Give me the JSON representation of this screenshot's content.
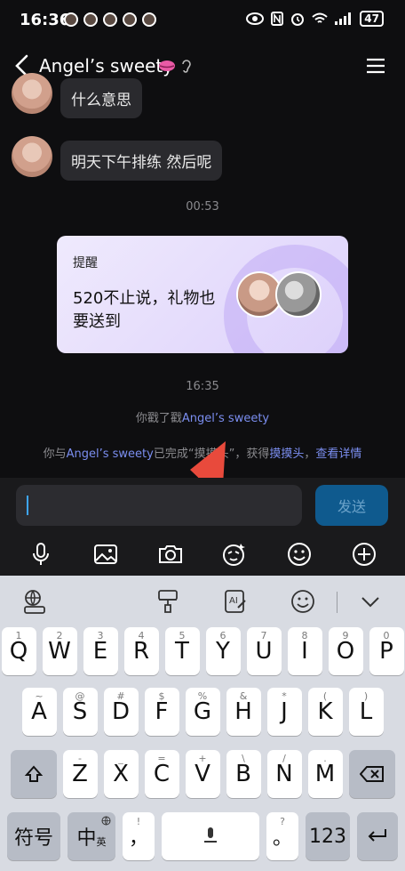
{
  "status": {
    "time": "16:36",
    "battery": "47"
  },
  "header": {
    "title": "Angel’s sweety"
  },
  "chat": {
    "messages": [
      {
        "text": "什么意思"
      },
      {
        "text": "明天下午排练 然后呢"
      }
    ],
    "timestamp1": "00:53",
    "card": {
      "title": "提醒",
      "body": "520不止说，礼物也要送到"
    },
    "timestamp2": "16:35",
    "poke": {
      "prefix": "你戳了戳",
      "name": "Angel’s sweety"
    },
    "complete": {
      "prefix": "你与",
      "name": "Angel’s sweety",
      "mid": "已完成“",
      "action": "摸摸头",
      "mid2": "”，获得",
      "reward": "摸摸头",
      "sep": "，",
      "detail": "查看详情"
    }
  },
  "input": {
    "send_label": "发送"
  },
  "keyboard": {
    "row1": [
      {
        "k": "Q",
        "s": "1"
      },
      {
        "k": "W",
        "s": "2"
      },
      {
        "k": "E",
        "s": "3"
      },
      {
        "k": "R",
        "s": "4"
      },
      {
        "k": "T",
        "s": "5"
      },
      {
        "k": "Y",
        "s": "6"
      },
      {
        "k": "U",
        "s": "7"
      },
      {
        "k": "I",
        "s": "8"
      },
      {
        "k": "O",
        "s": "9"
      },
      {
        "k": "P",
        "s": "0"
      }
    ],
    "row2": [
      {
        "k": "A",
        "s": "~"
      },
      {
        "k": "S",
        "s": "@"
      },
      {
        "k": "D",
        "s": "#"
      },
      {
        "k": "F",
        "s": "$"
      },
      {
        "k": "G",
        "s": "%"
      },
      {
        "k": "H",
        "s": "&"
      },
      {
        "k": "J",
        "s": "*"
      },
      {
        "k": "K",
        "s": "("
      },
      {
        "k": "L",
        "s": ")"
      }
    ],
    "row3": [
      {
        "k": "Z",
        "s": "-"
      },
      {
        "k": "X",
        "s": "_"
      },
      {
        "k": "C",
        "s": "="
      },
      {
        "k": "V",
        "s": "+"
      },
      {
        "k": "B",
        "s": "\\"
      },
      {
        "k": "N",
        "s": "/"
      },
      {
        "k": "M",
        "s": "."
      }
    ],
    "symbols": "符号",
    "lang": "中",
    "lang_sub": "英",
    "comma": "，",
    "comma_sub": "!",
    "period": "。",
    "period_sub": "?",
    "numbers": "123"
  }
}
